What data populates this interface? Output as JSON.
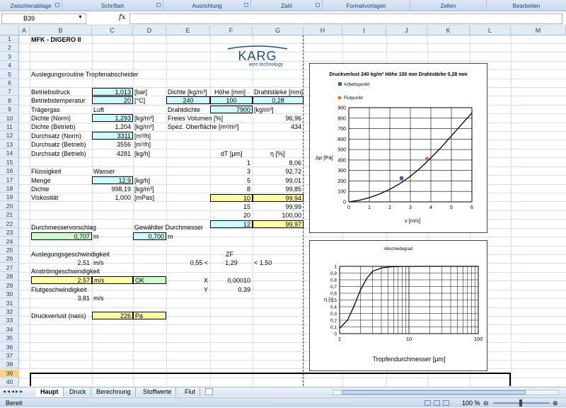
{
  "ribbon": {
    "groups": [
      "Zwischenablage",
      "Schriftart",
      "Ausrichtung",
      "Zahl",
      "Formatvorlagen",
      "Zellen",
      "Bearbeiten"
    ]
  },
  "formula_bar": {
    "name_box": "B39",
    "fx": "fx",
    "content": ""
  },
  "columns": [
    "A",
    "B",
    "C",
    "D",
    "E",
    "F",
    "G",
    "H",
    "I",
    "J",
    "K",
    "L",
    "M"
  ],
  "rows": [
    "1",
    "2",
    "3",
    "4",
    "5",
    "6",
    "7",
    "8",
    "9",
    "10",
    "11",
    "12",
    "13",
    "14",
    "15",
    "16",
    "17",
    "18",
    "19",
    "20",
    "21",
    "22",
    "23",
    "24",
    "25",
    "26",
    "27",
    "28",
    "29",
    "30",
    "31",
    "32",
    "33",
    "34",
    "35",
    "36",
    "37",
    "38",
    "39",
    "40"
  ],
  "selected_row": "39",
  "logo": {
    "name": "KARG",
    "tagline": "wire technology",
    "color": "#1e4f8c"
  },
  "cells": {
    "title": "MFK - DIGERO II",
    "subtitle": "Auslegungsroutine Tropfenabscheider",
    "betriebsdruck_l": "Betriebsdruck",
    "betriebsdruck_v": "1,013",
    "betriebsdruck_u": "[bar]",
    "betriebstemp_l": "Betriebstemperatur",
    "betriebstemp_v": "20",
    "betriebstemp_u": "[°C]",
    "traegergas_l": "Trägergas",
    "traegergas_v": "Luft",
    "dichte_norm_l": "Dichte (Norm)",
    "dichte_norm_v": "1,293",
    "dichte_norm_u": "[kg/m³]",
    "dichte_betr_l": "Dichte (Betrieb)",
    "dichte_betr_v": "1,204",
    "dichte_betr_u": "[kg/m³]",
    "durchsatz_norm_l": "Durchsatz (Norm)",
    "durchsatz_norm_v": "3311",
    "durchsatz_norm_u": "[m³/h]",
    "durchsatz_betr_l": "Durchsatz (Betrieb)",
    "durchsatz_betr_v": "3556",
    "durchsatz_betr_u": "[m³/h]",
    "durchsatz_betr2_l": "Durchsatz (Betrieb)",
    "durchsatz_betr2_v": "4281",
    "durchsatz_betr2_u": "[kg/h]",
    "dichte_hdr": "Dichte [kg/m³]",
    "hoehe_hdr": "Höhe [mm]",
    "drahtst_hdr": "Drahtstärke [mm]",
    "dichte_val": "240",
    "hoehe_val": "100",
    "drahtst_val": "0,28",
    "drahtdichte_l": "Drahtdichte",
    "drahtdichte_v": "7900",
    "drahtdichte_u": "[kg/m³]",
    "freies_vol_l": "Freies Volumen [%]",
    "freies_vol_v": "96,96",
    "spez_oberfl_l": "Spez. Oberfläche [m²/m³]",
    "spez_oberfl_v": "434",
    "dt_hdr": "dT [µm]",
    "eta_hdr": "η [%]",
    "d1": "1",
    "e1": "8,06",
    "d2": "3",
    "e2": "92,72",
    "d3": "5",
    "e3": "99,01",
    "d4": "8",
    "e4": "99,85",
    "d5": "10",
    "e5": "99,94",
    "d6": "15",
    "e6": "99,99",
    "d7": "20",
    "e7": "100,00",
    "d8": "12",
    "e8": "99,97",
    "fluessig_l": "Flüssigkeit",
    "fluessig_v": "Wasser",
    "menge_l": "Menge",
    "menge_v": "12,9",
    "menge_u": "[kg/h]",
    "dichte2_l": "Dichte",
    "dichte2_v": "998,19",
    "dichte2_u": "[kg/m³]",
    "visko_l": "Viskosität",
    "visko_v": "1,000",
    "visko_u": "[mPas]",
    "dm_vorschlag_l": "Durchmesservorschlag",
    "dm_vorschlag_v": "0,707",
    "dm_vorschlag_u": "m",
    "dm_gewaehlt_l": "Gewählter Durchmesser",
    "dm_gewaehlt_v": "0,700",
    "dm_gewaehlt_u": "m",
    "ausl_geschw_l": "Auslegungsgeschwindigkeit",
    "ausl_geschw_v": "2,51",
    "ausl_geschw_u": "m/s",
    "zf_l": "ZF",
    "zf_low": "0,55 <",
    "zf_v": "1,29",
    "zf_high": "< 1,50",
    "anstroem_l": "Anströmgeschwindigkeit",
    "anstroem_v": "2,57",
    "anstroem_u": "m/s",
    "anstroem_ok": "OK",
    "x_l": "X",
    "x_v": "0,00010",
    "flut_l": "Flutgeschwindigkeit",
    "y_l": "Y",
    "y_v": "0,39",
    "flut_v": "3,81",
    "flut_u": "m/s",
    "druckverl_l": "Druckverlust (nass)",
    "druckverl_v": "226",
    "druckverl_u": "Pa"
  },
  "chart_data": [
    {
      "type": "line",
      "title": "Druckverlust 240 kg/m³ Höhe 100 mm Drahtstärke 0,28 mm",
      "xlabel": "v [m/s]",
      "ylabel": "Δp [Pa]",
      "xlim": [
        0,
        6
      ],
      "ylim": [
        0,
        900
      ],
      "xticks": [
        "0",
        "1",
        "2",
        "3",
        "4",
        "5",
        "6"
      ],
      "yticks": [
        "0",
        "100",
        "200",
        "300",
        "400",
        "500",
        "600",
        "700",
        "800",
        "900"
      ],
      "grid": true,
      "series": [
        {
          "type": "line",
          "x": [
            0,
            0.5,
            1,
            1.5,
            2,
            2.5,
            3,
            3.5,
            4,
            4.5,
            5,
            5.5,
            6
          ],
          "y": [
            0,
            15,
            40,
            75,
            120,
            175,
            245,
            325,
            420,
            520,
            630,
            740,
            850
          ],
          "color": "#000000"
        },
        {
          "name": "Arbeitspunkt",
          "type": "scatter",
          "x": [
            2.57
          ],
          "y": [
            226
          ],
          "color": "#2f5fa8"
        },
        {
          "name": "Flutpunkt",
          "type": "scatter",
          "x": [
            3.81
          ],
          "y": [
            412
          ],
          "color": "#e07040"
        }
      ],
      "legend": "top-left"
    },
    {
      "type": "line",
      "title": "Abscheidegrad",
      "xlabel": "Tropfendurchmesser [µm]",
      "ylabel": "η [-]",
      "xscale": "log",
      "xlim": [
        1,
        100
      ],
      "ylim": [
        0,
        1
      ],
      "xticks": [
        "1",
        "10",
        "100"
      ],
      "yticks": [
        "0",
        "0,1",
        "0,2",
        "0,3",
        "0,4",
        "0,5",
        "0,6",
        "0,7",
        "0,8",
        "0,9",
        "1"
      ],
      "grid": true,
      "series": [
        {
          "x": [
            1,
            1.3,
            1.6,
            2,
            2.5,
            3,
            4,
            5,
            6,
            8,
            10,
            15,
            20,
            50,
            100
          ],
          "y": [
            0.08,
            0.2,
            0.4,
            0.65,
            0.83,
            0.927,
            0.975,
            0.99,
            0.995,
            0.9985,
            0.9994,
            0.9999,
            1,
            1,
            1
          ],
          "color": "#000000"
        }
      ]
    }
  ],
  "sheet_tabs": [
    "Haupt",
    "Druck",
    "Berechnung",
    "Stoffwerte",
    "Flut"
  ],
  "active_tab": "Haupt",
  "status": {
    "left": "Bereit",
    "zoom": "100 %"
  }
}
